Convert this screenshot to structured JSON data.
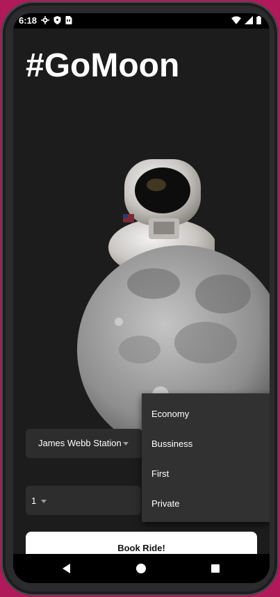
{
  "status_bar": {
    "time": "6:18",
    "left_icons": [
      "settings-icon",
      "shield-icon",
      "sim-card-icon"
    ],
    "right_icons": [
      "wifi-icon",
      "signal-icon",
      "battery-icon"
    ]
  },
  "app": {
    "title": "#GoMoon",
    "destination_dropdown": {
      "selected": "James Webb Station"
    },
    "travellers_dropdown": {
      "selected": "1"
    },
    "class_menu": {
      "options": [
        "Economy",
        "Bussiness",
        "First",
        "Private"
      ]
    },
    "book_button_label": "Book Ride!"
  },
  "colors": {
    "background": "#1c1c1c",
    "field_background": "#2d2d2d",
    "menu_background": "#313131",
    "button_background": "#ffffff"
  },
  "nav_bar": {
    "icons": [
      "back-icon",
      "home-icon",
      "recents-icon"
    ]
  }
}
